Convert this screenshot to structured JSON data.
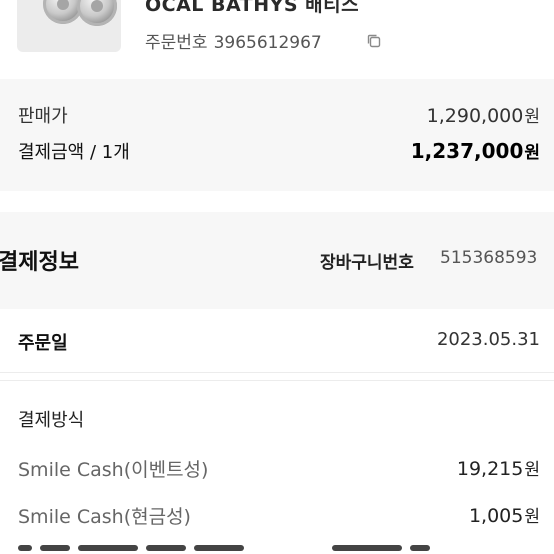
{
  "product": {
    "name": "OCAL BATHYS 배티스",
    "order_label": "주문번호",
    "order_number": "3965612967",
    "thumbnail_icon": "product-thumbnail",
    "copy_icon": "copy-icon"
  },
  "price_summary": {
    "sale_label": "판매가",
    "sale_value": "1,290,000",
    "pay_label": "결제금액 / 1개",
    "pay_value": "1,237,000",
    "currency": "원"
  },
  "payment_info": {
    "title": "결제정보",
    "cart_label": "장바구니번호",
    "cart_number": "515368593"
  },
  "order_date": {
    "label": "주문일",
    "value": "2023.05.31"
  },
  "payment_method": {
    "title": "결제방식",
    "items": [
      {
        "label": "Smile Cash(이벤트성)",
        "amount": "19,215"
      },
      {
        "label": "Smile Cash(현금성)",
        "amount": "1,005"
      }
    ],
    "currency": "원"
  },
  "colors": {
    "background": "#ffffff",
    "section_bg": "#f7f7f7",
    "text_primary": "#111111",
    "text_secondary": "#666666"
  }
}
